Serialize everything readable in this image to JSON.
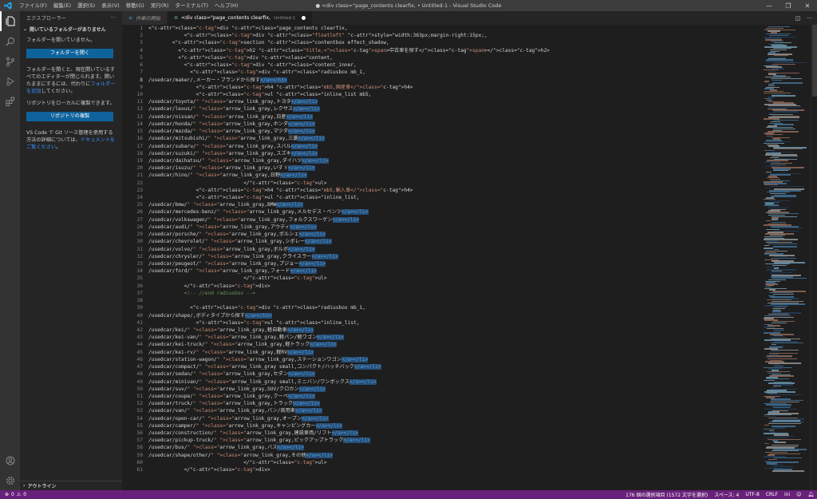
{
  "titlebar": {
    "menus": [
      "ファイル(F)",
      "編集(E)",
      "選択(S)",
      "表示(V)",
      "移動(G)",
      "実行(R)",
      "ターミナル(T)",
      "ヘルプ(H)"
    ],
    "title": "● <div class=\"page_contents clearfix, • Untitled-1 - Visual Studio Code",
    "controls": {
      "minimize": "—",
      "restore": "❐",
      "close": "✕"
    }
  },
  "sidebar": {
    "title": "エクスプローラー",
    "more": "···",
    "section_title": "開いているフォルダーがありません",
    "no_folder": "フォルダーを開いていません。",
    "open_folder_button": "フォルダーを開く",
    "info_text": "フォルダーを開くと、現在開いているすべてのエディターが閉じられます。開いたままにするには、代わりに",
    "info_link": "フォルダーを追加",
    "info_tail": "してください。",
    "clone_text": "リポジトリをローカルに複製できます。",
    "clone_button": "リポジトリの複製",
    "git_text": "VS Code で Git ソース管理を使用する方法の詳細については、",
    "git_link": "ドキュメントをご覧ください",
    "git_tail": "。",
    "outline": "アウトライン"
  },
  "tabs": [
    {
      "label": "作業の開始",
      "active": false
    },
    {
      "label": "<div class=\"page_contents clearfix,",
      "sub": "Untitled-1",
      "active": true
    }
  ],
  "editor": {
    "start_line": 1,
    "current_line": 8,
    "lines": [
      "<div class=\"page_contents clearfix,",
      "            <div class=\"floatleft\" style=\"width:363px;margin-right:15px;,",
      "        <section class=\"contentbox effect_shadow,",
      "          <h2 class=\"title,<span>中古車を探す</span></h2>",
      "          <div class=\"content,",
      "            <div class=\"content_inner,",
      "              <div class=\"radiusbox mb_1,",
      "/usedcar/maker/,メーカー・ブランドから探す</a></h3>",
      "                <h4 class=\"mb5,国産車</h4>",
      "                <ul class=\"inline_list mb5,",
      "/usedcar/toyota/\" class=\"arrow_link_gray,トヨタ</a></li>",
      "/usedcar/lexus/\" class=\"arrow_link_gray,レクサス</a></li>",
      "/usedcar/nissan/\" class=\"arrow_link_gray,日産</a></li>",
      "/usedcar/honda/\" class=\"arrow_link_gray,ホンダ</a></li>",
      "/usedcar/mazda/\" class=\"arrow_link_gray,マツダ</a></li>",
      "/usedcar/mitsubishi/\" class=\"arrow_link_gray,三菱</a></li>",
      "/usedcar/subaru/\" class=\"arrow_link_gray,スバル</a></li>",
      "/usedcar/suzuki/\" class=\"arrow_link_gray,スズキ</a></li>",
      "/usedcar/daihatsu/\" class=\"arrow_link_gray,ダイハツ</a></li>",
      "/usedcar/isuzu/\" class=\"arrow_link_gray,いすゞ</a></li>",
      "/usedcar/hino/\" class=\"arrow_link_gray,日野</a></li>",
      "                                </ul>",
      "                <h4 class=\"mb5,輸入車</h4>",
      "                <ul class=\"inline_list,",
      "/usedcar/bmw/\" class=\"arrow_link_gray,BMW</a></li>",
      "/usedcar/mercedes-benz/\" class=\"arrow_link_gray,メルセデス・ベンツ</a></li>",
      "/usedcar/volkswagen/\" class=\"arrow_link_gray,フォルクスワーゲン</a></li>",
      "/usedcar/audi/\" class=\"arrow_link_gray,アウディ</a></li>",
      "/usedcar/porsche/\" class=\"arrow_link_gray,ポルシェ</a></li>",
      "/usedcar/chevrolet/\" class=\"arrow_link_gray,シボレー</a></li>",
      "/usedcar/volvo/\" class=\"arrow_link_gray,ボルボ</a></li>",
      "/usedcar/chrysler/\" class=\"arrow_link_gray,クライスラー</a></li>",
      "/usedcar/peugeot/\" class=\"arrow_link_gray,プジョー</a></li>",
      "/usedcar/ford/\" class=\"arrow_link_gray,フォード</a></li>",
      "                                </ul>",
      "            </div>",
      "            <!-- //end radiusbox -->",
      "",
      "              <div class=\"radiusbox mb_1,",
      "/usedcar/shape/,ボディタイプから探す</a></h3>",
      "                <ul class=\"inline_list,",
      "/usedcar/kei/\" class=\"arrow_link_gray,軽自動車</a></li>",
      "/usedcar/kei-van/\" class=\"arrow_link_gray,軽バン/軽ワゴン</a></li>",
      "/usedcar/kei-truck/\" class=\"arrow_link_gray,軽トラック</a></li>",
      "/usedcar/kei-rv/\" class=\"arrow_link_gray,軽RV</a></li>",
      "/usedcar/station-wagon/\" class=\"arrow_link_gray,ステーションワゴン</a></li>",
      "/usedcar/compact/\" class=\"arrow_link_gray small,コンパクト/ハッチバック</a></li>",
      "/usedcar/sedan/\" class=\"arrow_link_gray,セダン</a></li>",
      "/usedcar/minivan/\" class=\"arrow_link_gray small,ミニバン/ワンボックス</a></li>",
      "/usedcar/suv/\" class=\"arrow_link_gray,SUV/クロカン</a></li>",
      "/usedcar/coupe/\" class=\"arrow_link_gray,クーペ</a></li>",
      "/usedcar/truck/\" class=\"arrow_link_gray,トラック</a></li>",
      "/usedcar/van/\" class=\"arrow_link_gray,バン/商用車</a></li>",
      "/usedcar/open-car/\" class=\"arrow_link_gray,オープン</a></li>",
      "/usedcar/camper/\" class=\"arrow_link_gray,キャンピングカー</a></li>",
      "/usedcar/construction/\" class=\"arrow_link_gray,建設車両/リフト</a></li>",
      "/usedcar/pickup-truck/\" class=\"arrow_link_gray,ピックアップトラック</a></li>",
      "/usedcar/bus/\" class=\"arrow_link_gray,バス</a></li>",
      "/usedcar/shape/other/\" class=\"arrow_link_gray,その他</a></li>",
      "                                </ul>",
      "            </div>"
    ]
  },
  "statusbar": {
    "problems": "0",
    "warnings": "0",
    "selection": "176 個の選択項目 (1572 文字を選択)",
    "spaces": "スペース: 4",
    "encoding": "UTF-8",
    "eol": "CRLF",
    "language": "ini"
  },
  "colors": {
    "statusbar": "#68217a",
    "button": "#0e639c",
    "selection": "#264f78",
    "tag": "#569cd6",
    "attribute": "#9cdcfe",
    "string": "#ce9178",
    "comment": "#6a9955"
  },
  "icons": {
    "activity": [
      "explorer-icon",
      "search-icon",
      "source-control-icon",
      "run-debug-icon",
      "extensions-icon"
    ],
    "activity_bottom": [
      "account-icon",
      "settings-gear-icon"
    ]
  }
}
